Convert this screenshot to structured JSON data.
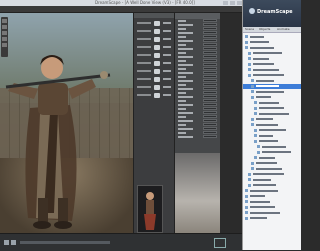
{
  "app": {
    "title": "DreamScape - [A Well Done View (V3) - [FR 40.0]]",
    "menu": [
      "File",
      "Edit",
      "Create",
      "Window",
      "Help"
    ]
  },
  "sidebar": {
    "brand": "DreamScape",
    "tabs": [
      "Scene",
      "Objects",
      "Animate"
    ]
  }
}
